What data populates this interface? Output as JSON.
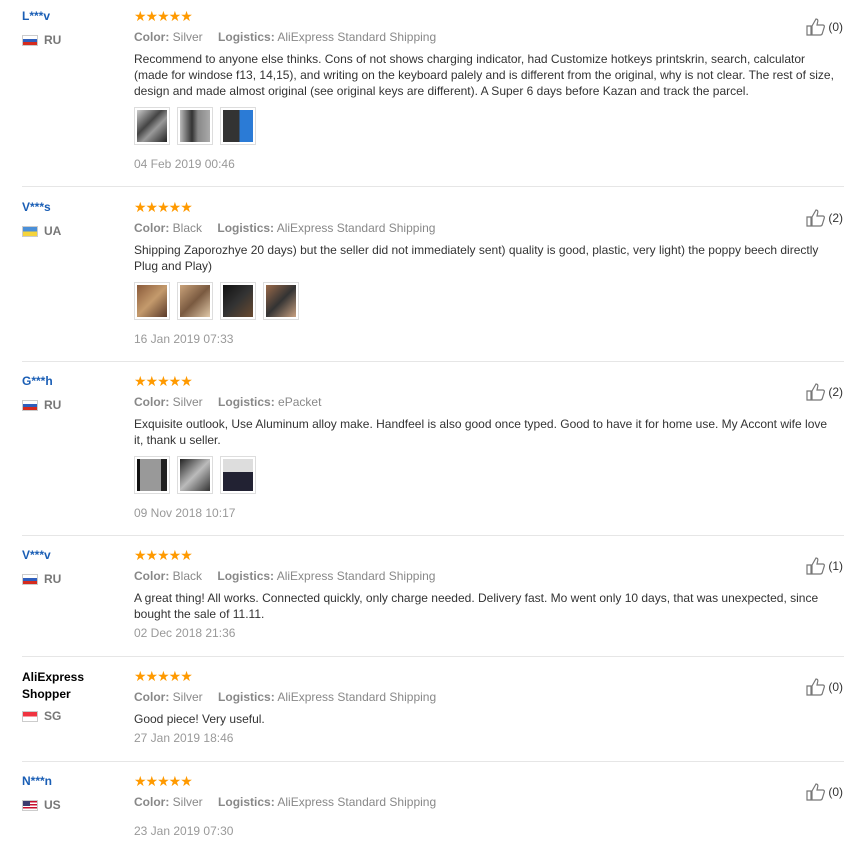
{
  "labels": {
    "color": "Color:",
    "logistics": "Logistics:"
  },
  "reviews": [
    {
      "user": "L***v",
      "country": "RU",
      "color": "Silver",
      "logistics": "AliExpress Standard Shipping",
      "text": "Recommend to anyone else thinks. Cons of not shows charging indicator, had Customize hotkeys printskrin, search, calculator (made for windose f13, 14,15), and writing on the keyboard palely and is different from the original, why is not clear. The rest of size, design and made almost original (see original keys are different). A Super 6 days before Kazan and track the parcel.",
      "date": "04 Feb 2019 00:46",
      "likes": "(0)"
    },
    {
      "user": "V***s",
      "country": "UA",
      "color": "Black",
      "logistics": "AliExpress Standard Shipping",
      "text": "Shipping Zaporozhye 20 days) but the seller did not immediately sent) quality is good, plastic, very light) the poppy beech directly Plug and Play)",
      "date": "16 Jan 2019 07:33",
      "likes": "(2)"
    },
    {
      "user": "G***h",
      "country": "RU",
      "color": "Silver",
      "logistics": "ePacket",
      "text": "Exquisite outlook, Use Aluminum alloy make. Handfeel is also good once typed. Good to have it for home use. My Accont wife love it, thank u seller.",
      "date": "09 Nov 2018 10:17",
      "likes": "(2)"
    },
    {
      "user": "V***v",
      "country": "RU",
      "color": "Black",
      "logistics": "AliExpress Standard Shipping",
      "text": "A great thing! All works. Connected quickly, only charge needed. Delivery fast. Mo went only 10 days, that was unexpected, since bought the sale of 11.11.",
      "date": "02 Dec 2018 21:36",
      "likes": "(1)"
    },
    {
      "user": "AliExpress Shopper",
      "country": "SG",
      "color": "Silver",
      "logistics": "AliExpress Standard Shipping",
      "text": "Good piece! Very useful.",
      "date": "27 Jan 2019 18:46",
      "likes": "(0)"
    },
    {
      "user": "N***n",
      "country": "US",
      "color": "Silver",
      "logistics": "AliExpress Standard Shipping",
      "text": "",
      "date": "23 Jan 2019 07:30",
      "likes": "(0)"
    }
  ],
  "stars": "★★★★★",
  "icons": {
    "like": "thumbs-up-icon",
    "star": "star-icon",
    "flag": "country-flag-icon"
  },
  "colors": {
    "star": "#ff9a00",
    "username": "#1a5eb5",
    "meta": "#888888"
  }
}
